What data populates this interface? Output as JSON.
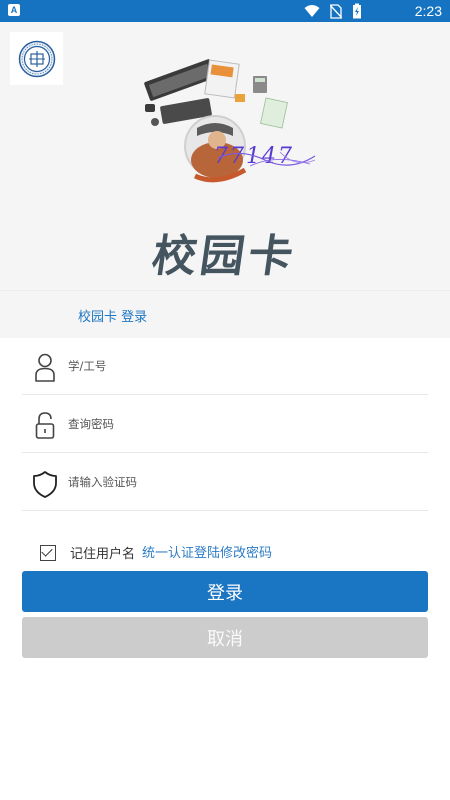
{
  "status_bar": {
    "app_badge": "A",
    "time": "2:23",
    "icons": [
      "wifi-icon",
      "no-sim-icon",
      "battery-charging-icon"
    ]
  },
  "header": {
    "title": "校园卡"
  },
  "tabs": [
    {
      "label": "校园卡 登录",
      "active": true
    }
  ],
  "form": {
    "username": {
      "placeholder": "学/工号",
      "value": "",
      "icon": "user-icon"
    },
    "password": {
      "placeholder": "查询密码",
      "value": "",
      "icon": "lock-icon"
    },
    "captcha": {
      "placeholder": "请输入验证码",
      "value": "",
      "icon": "shield-icon",
      "image_text": "77147"
    }
  },
  "remember": {
    "label": "记住用户名",
    "checked": true
  },
  "links": {
    "change_password": "统一认证登陆修改密码"
  },
  "buttons": {
    "login": "登录",
    "cancel": "取消"
  },
  "colors": {
    "primary": "#1a75c2",
    "status_bar": "#1573c1",
    "cancel": "#cccccc",
    "link": "#2d7cc4"
  }
}
